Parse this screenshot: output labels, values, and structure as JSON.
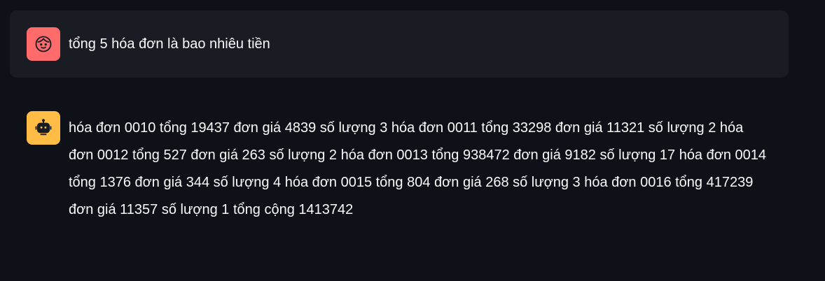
{
  "messages": {
    "user": {
      "avatar_icon": "face-icon",
      "avatar_color": "#ff6b6b",
      "text": "tổng 5 hóa đơn là bao nhiêu tiền"
    },
    "assistant": {
      "avatar_icon": "robot-icon",
      "avatar_color": "#ffbd45",
      "text": "hóa đơn 0010 tổng 19437 đơn giá 4839 số lượng 3 hóa đơn 0011 tổng 33298 đơn giá 11321 số lượng 2 hóa đơn 0012 tổng 527 đơn giá 263 số lượng 2 hóa đơn 0013 tổng 938472 đơn giá 9182 số lượng 17 hóa đơn 0014 tổng 1376 đơn giá 344 số lượng 4 hóa đơn 0015 tổng 804 đơn giá 268 số lượng 3 hóa đơn 0016 tổng 417239 đơn giá 11357 số lượng 1 tổng cộng 1413742"
    }
  },
  "colors": {
    "background": "#0e1117",
    "user_bubble": "#1a1c24",
    "text": "#fafafa"
  }
}
